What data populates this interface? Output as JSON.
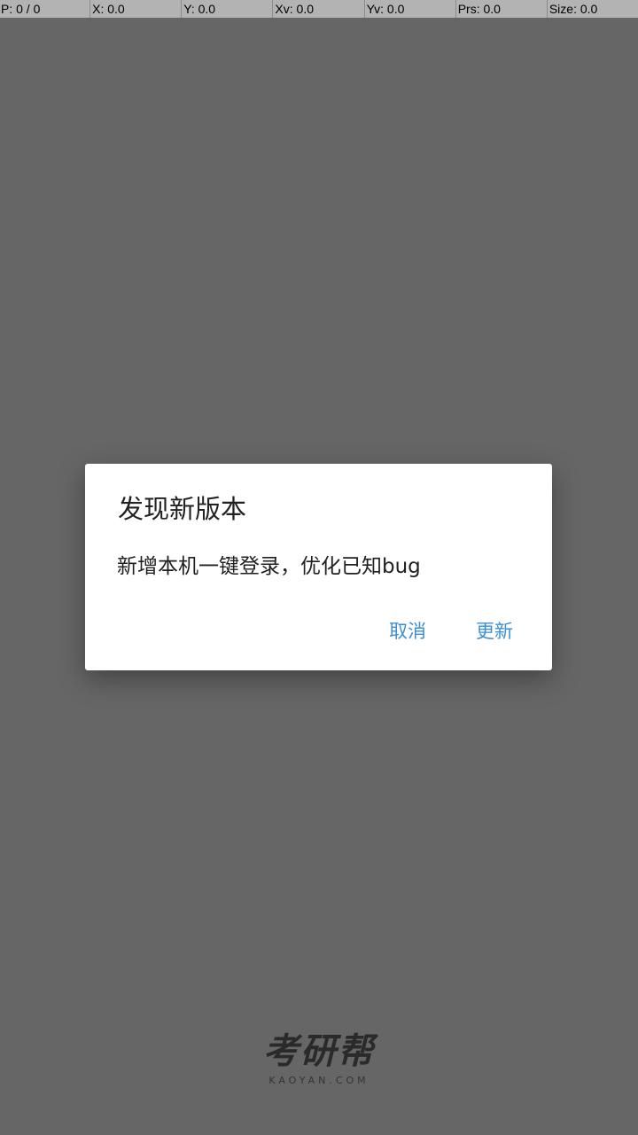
{
  "debug_bar": [
    "P: 0 / 0",
    "X: 0.0",
    "Y: 0.0",
    "Xv: 0.0",
    "Yv: 0.0",
    "Prs: 0.0",
    "Size: 0.0"
  ],
  "dialog": {
    "title": "发现新版本",
    "message": "新增本机一键登录，优化已知bug",
    "cancel_label": "取消",
    "update_label": "更新"
  },
  "logo": {
    "main": "考研帮",
    "sub": "KAOYAN.COM"
  },
  "colors": {
    "background": "#666666",
    "accent": "#3b8fd6",
    "debug_bar": "#b3b3b3"
  }
}
